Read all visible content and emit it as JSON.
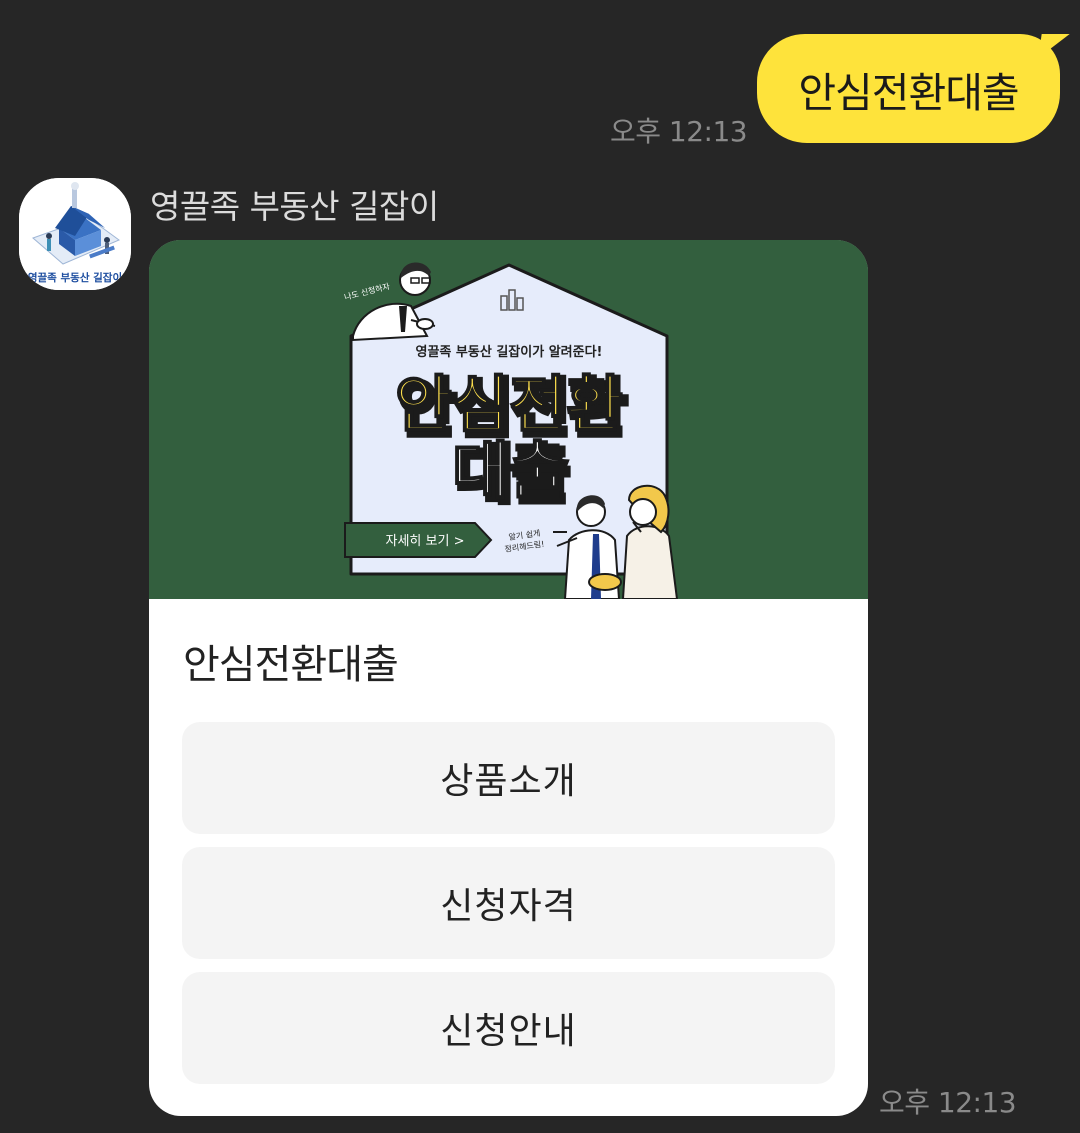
{
  "outgoing": {
    "text": "안심전환대출",
    "time": "오후 12:13"
  },
  "incoming": {
    "sender_name": "영끌족 부동산 길잡이",
    "avatar_caption": "영끌족 부동산 길잡이",
    "time": "오후 12:13",
    "card": {
      "banner": {
        "top_caption": "영끌족 부동산 길잡이가 알려준다!",
        "headline_line1": "안심전환",
        "headline_line2": "대출",
        "detail_button": "자세히 보기 >",
        "note_left": "나도 신청하자",
        "note_right_line1": "알기 쉽게",
        "note_right_line2": "정리해드림!",
        "colors": {
          "background": "#335f3e",
          "house": "#e6ecfb",
          "headline": "#ffe14d"
        }
      },
      "title": "안심전환대출",
      "buttons": [
        {
          "label": "상품소개"
        },
        {
          "label": "신청자격"
        },
        {
          "label": "신청안내"
        }
      ]
    }
  },
  "colors": {
    "chat_background": "#262626",
    "outgoing_bubble": "#fee33b",
    "card_button": "#f4f4f4"
  }
}
